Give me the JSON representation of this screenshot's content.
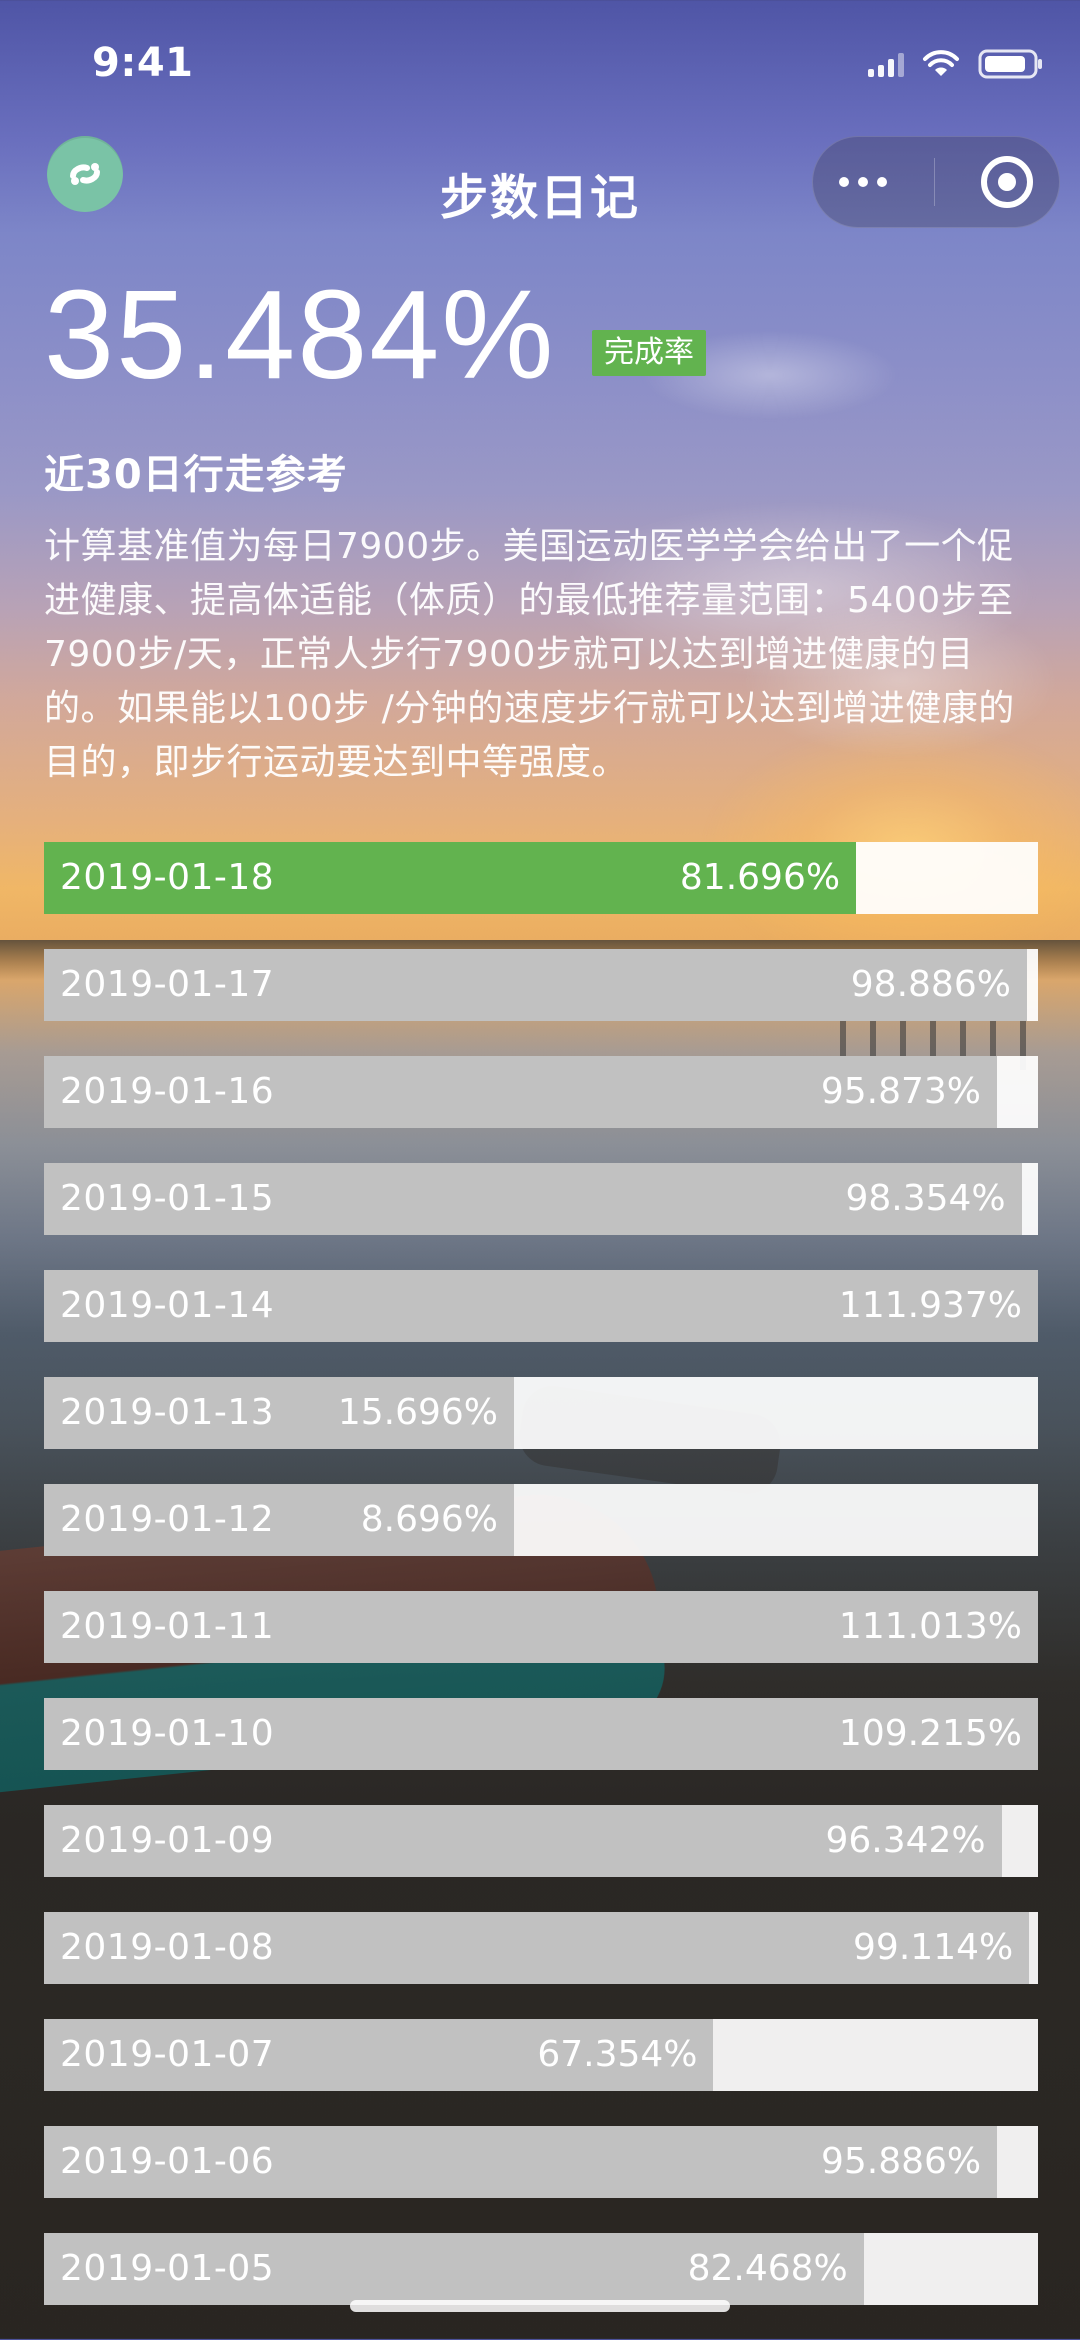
{
  "status_bar": {
    "time": "9:41",
    "icons": [
      "cellular-signal-icon",
      "wifi-icon",
      "battery-icon"
    ]
  },
  "nav": {
    "title": "步数日记",
    "logo_icon": "app-logo-icon",
    "menu_icon": "more-dots-icon",
    "close_icon": "target-close-icon"
  },
  "summary": {
    "completion_rate": "35.484%",
    "badge_label": "完成率"
  },
  "reference": {
    "title": "近30日行走参考",
    "description": "计算基准值为每日7900步。美国运动医学学会给出了一个促进健康、提高体适能（体质）的最低推荐量范围：5400步至7900步/天，正常人步行7900步就可以达到增进健康的目的。如果能以100步 /分钟的速度步行就可以达到增进健康的目的，即步行运动要达到中等强度。"
  },
  "colors": {
    "today_fill": "#62b34f",
    "past_fill": "#bebebe",
    "track": "#f2f2f2"
  },
  "records": [
    {
      "date": "2019-01-18",
      "percent_label": "81.696%",
      "percent": 81.696,
      "today": true
    },
    {
      "date": "2019-01-17",
      "percent_label": "98.886%",
      "percent": 98.886,
      "today": false
    },
    {
      "date": "2019-01-16",
      "percent_label": "95.873%",
      "percent": 95.873,
      "today": false
    },
    {
      "date": "2019-01-15",
      "percent_label": "98.354%",
      "percent": 98.354,
      "today": false
    },
    {
      "date": "2019-01-14",
      "percent_label": "111.937%",
      "percent": 111.937,
      "today": false
    },
    {
      "date": "2019-01-13",
      "percent_label": "15.696%",
      "percent": 15.696,
      "today": false
    },
    {
      "date": "2019-01-12",
      "percent_label": "8.696%",
      "percent": 8.696,
      "today": false
    },
    {
      "date": "2019-01-11",
      "percent_label": "111.013%",
      "percent": 111.013,
      "today": false
    },
    {
      "date": "2019-01-10",
      "percent_label": "109.215%",
      "percent": 109.215,
      "today": false
    },
    {
      "date": "2019-01-09",
      "percent_label": "96.342%",
      "percent": 96.342,
      "today": false
    },
    {
      "date": "2019-01-08",
      "percent_label": "99.114%",
      "percent": 99.114,
      "today": false
    },
    {
      "date": "2019-01-07",
      "percent_label": "67.354%",
      "percent": 67.354,
      "today": false
    },
    {
      "date": "2019-01-06",
      "percent_label": "95.886%",
      "percent": 95.886,
      "today": false
    },
    {
      "date": "2019-01-05",
      "percent_label": "82.468%",
      "percent": 82.468,
      "today": false
    }
  ]
}
